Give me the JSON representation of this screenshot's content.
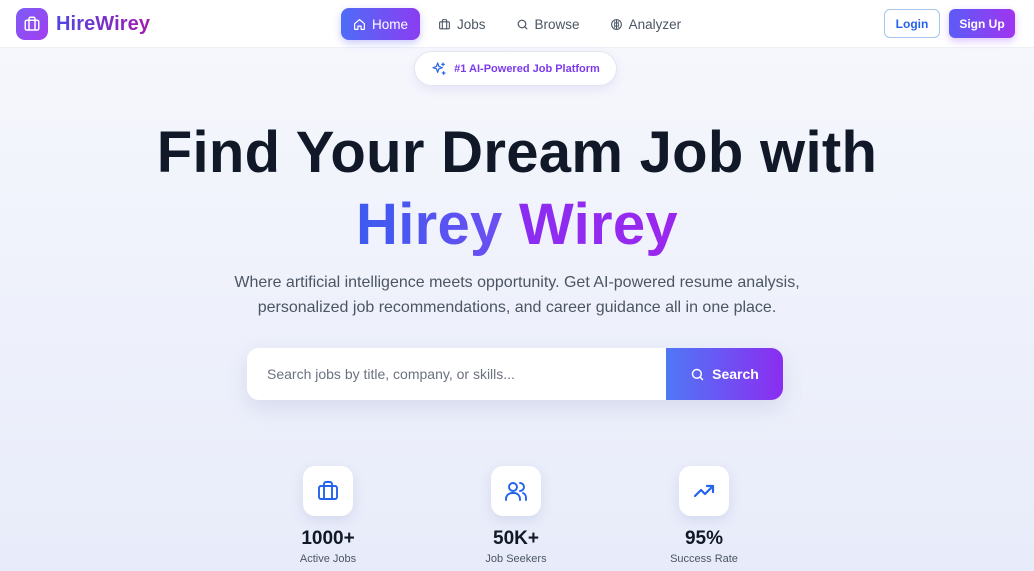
{
  "brand": {
    "name": "HireWirey",
    "logo_icon": "briefcase-icon",
    "accent": "#7c3aed"
  },
  "nav": {
    "links": [
      {
        "label": "Home",
        "icon": "home-icon",
        "active": true
      },
      {
        "label": "Jobs",
        "icon": "briefcase-icon",
        "active": false
      },
      {
        "label": "Browse",
        "icon": "search-icon",
        "active": false
      },
      {
        "label": "Analyzer",
        "icon": "brain-icon",
        "active": false
      }
    ],
    "login_label": "Login",
    "signup_label": "Sign Up"
  },
  "badge": {
    "label": "#1 AI-Powered Job Platform",
    "icon": "sparkles-icon"
  },
  "hero": {
    "line1": "Find Your Dream Job with",
    "line2_word1": "Hirey",
    "line2_word2": "Wirey",
    "subtitle_line1": "Where artificial intelligence meets opportunity. Get AI-powered resume analysis,",
    "subtitle_line2": "personalized job recommendations, and career guidance all in one place."
  },
  "search": {
    "placeholder": "Search jobs by title, company, or skills...",
    "value": "",
    "button_label": "Search"
  },
  "stats": [
    {
      "value": "1000+",
      "label": "Active Jobs",
      "icon": "briefcase-icon"
    },
    {
      "value": "50K+",
      "label": "Job Seekers",
      "icon": "users-icon"
    },
    {
      "value": "95%",
      "label": "Success Rate",
      "icon": "trending-up-icon"
    }
  ],
  "colors": {
    "primary_blue": "#2563eb",
    "primary_purple": "#8b2cf0",
    "gradient_start": "#4f6cf6",
    "gradient_end": "#a034f0"
  }
}
